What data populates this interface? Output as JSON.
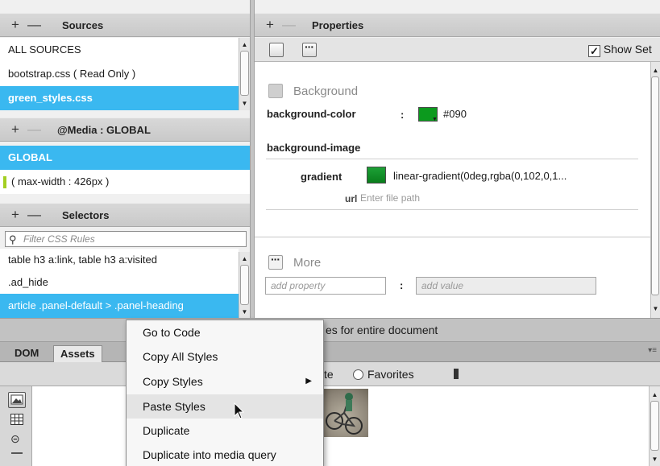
{
  "sources": {
    "title": "Sources",
    "items": [
      "ALL SOURCES",
      "bootstrap.css  ( Read Only )",
      "green_styles.css"
    ],
    "selected_index": 2
  },
  "media": {
    "title": "@Media : GLOBAL",
    "items": [
      "GLOBAL",
      "( max-width : 426px )"
    ],
    "selected_index": 0
  },
  "selectors": {
    "title": "Selectors",
    "filter_placeholder": "Filter CSS Rules",
    "items": [
      "table h3 a:link, table h3 a:visited",
      ".ad_hide",
      "article .panel-default > .panel-heading"
    ],
    "selected_index": 2
  },
  "properties": {
    "title": "Properties",
    "show_set_label": "Show Set",
    "show_set_checked": true,
    "background_section": "Background",
    "background_color_label": "background-color",
    "colon": ":",
    "background_color_value": "#090",
    "background_image_label": "background-image",
    "gradient_label": "gradient",
    "gradient_value": "linear-gradient(0deg,rgba(0,102,0,1...",
    "url_label": "url",
    "url_placeholder": "Enter file path",
    "more_section": "More",
    "add_property_placeholder": "add property",
    "add_value_placeholder": "add value"
  },
  "status": {
    "text": "es for entire document"
  },
  "bottom_tabs": [
    "DOM",
    "Assets"
  ],
  "assets_toolbar": {
    "site_fragment": "te",
    "favorites_label": "Favorites"
  },
  "context_menu": {
    "items": [
      "Go to Code",
      "Copy All Styles",
      "Copy Styles",
      "Paste Styles",
      "Duplicate",
      "Duplicate into media query"
    ],
    "hover_index": 3,
    "submenu_index": 2
  },
  "colors": {
    "selection": "#3ab8f0",
    "swatch": "#009900",
    "media_marker": "#a3cf22"
  },
  "icons": [
    "plus-icon",
    "minus-icon",
    "search-icon",
    "checkbox-icon",
    "more-icon",
    "image-icon",
    "grid-icon",
    "link-icon",
    "favorite-icon",
    "cursor-icon"
  ]
}
